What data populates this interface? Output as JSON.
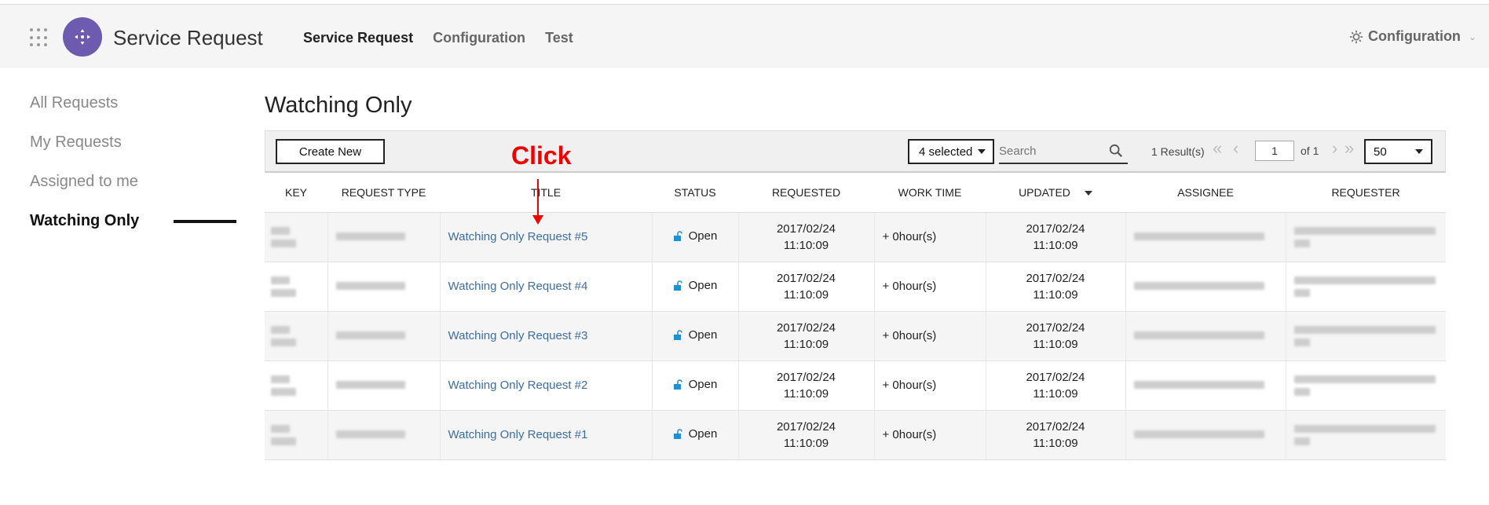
{
  "header": {
    "app_title": "Service Request",
    "nav": [
      {
        "label": "Service Request",
        "active": true
      },
      {
        "label": "Configuration",
        "active": false
      },
      {
        "label": "Test",
        "active": false
      }
    ],
    "config_label": "Configuration",
    "logo_color": "#6c5bae"
  },
  "sidebar": {
    "items": [
      {
        "label": "All Requests",
        "active": false
      },
      {
        "label": "My Requests",
        "active": false
      },
      {
        "label": "Assigned to me",
        "active": false
      },
      {
        "label": "Watching Only",
        "active": true
      }
    ]
  },
  "main": {
    "page_title": "Watching Only",
    "toolbar": {
      "create_label": "Create New",
      "selected_label": "4 selected",
      "search_placeholder": "Search",
      "results_text": "1 Result(s)",
      "page_value": "1",
      "of_text": "of 1",
      "per_page": "50"
    },
    "annotation": {
      "text": "Click",
      "color": "#ee0000"
    },
    "columns": [
      "KEY",
      "REQUEST TYPE",
      "TITLE",
      "STATUS",
      "REQUESTED",
      "WORK TIME",
      "UPDATED",
      "ASSIGNEE",
      "REQUESTER"
    ],
    "rows": [
      {
        "title": "Watching Only Request #5",
        "status": "Open",
        "requested_date": "2017/02/24",
        "requested_time": "11:10:09",
        "work_time": "+ 0hour(s)",
        "updated_date": "2017/02/24",
        "updated_time": "11:10:09"
      },
      {
        "title": "Watching Only Request #4",
        "status": "Open",
        "requested_date": "2017/02/24",
        "requested_time": "11:10:09",
        "work_time": "+ 0hour(s)",
        "updated_date": "2017/02/24",
        "updated_time": "11:10:09"
      },
      {
        "title": "Watching Only Request #3",
        "status": "Open",
        "requested_date": "2017/02/24",
        "requested_time": "11:10:09",
        "work_time": "+ 0hour(s)",
        "updated_date": "2017/02/24",
        "updated_time": "11:10:09"
      },
      {
        "title": "Watching Only Request #2",
        "status": "Open",
        "requested_date": "2017/02/24",
        "requested_time": "11:10:09",
        "work_time": "+ 0hour(s)",
        "updated_date": "2017/02/24",
        "updated_time": "11:10:09"
      },
      {
        "title": "Watching Only Request #1",
        "status": "Open",
        "requested_date": "2017/02/24",
        "requested_time": "11:10:09",
        "work_time": "+ 0hour(s)",
        "updated_date": "2017/02/24",
        "updated_time": "11:10:09"
      }
    ]
  }
}
